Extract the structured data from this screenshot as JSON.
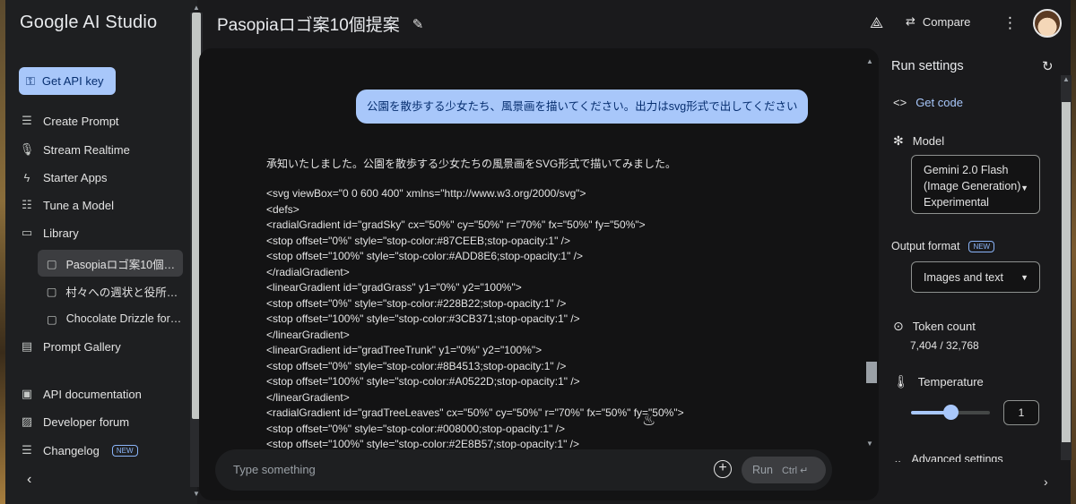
{
  "app": {
    "name": "Google AI Studio",
    "prompt_title": "Pasopiaロゴ案10個提案"
  },
  "sidebar": {
    "api_key_label": "Get API key",
    "nav": [
      {
        "label": "Create Prompt",
        "icon": "create-prompt-icon"
      },
      {
        "label": "Stream Realtime",
        "icon": "microphone-icon"
      },
      {
        "label": "Starter Apps",
        "icon": "bolt-icon"
      },
      {
        "label": "Tune a Model",
        "icon": "tune-icon"
      },
      {
        "label": "Library",
        "icon": "library-icon"
      }
    ],
    "library_items": [
      {
        "label": "Pasopiaロゴ案10個提案",
        "active": true
      },
      {
        "label": "村々への週状と役所の…",
        "active": false
      },
      {
        "label": "Chocolate Drizzle for …",
        "active": false
      }
    ],
    "prompt_gallery": "Prompt Gallery",
    "footer": [
      {
        "label": "API documentation",
        "icon": "document-icon"
      },
      {
        "label": "Developer forum",
        "icon": "forum-icon"
      },
      {
        "label": "Changelog",
        "icon": "changelog-icon",
        "badge": "NEW"
      }
    ]
  },
  "header": {
    "compare_label": "Compare"
  },
  "chat": {
    "user_message": "公園を散歩する少女たち、風景画を描いてください。出力はsvg形式で出してください",
    "reply_intro": "承知いたしました。公園を散歩する少女たちの風景画をSVG形式で描いてみました。",
    "reply_lines": [
      "<svg viewBox=\"0 0 600 400\" xmlns=\"http://www.w3.org/2000/svg\">",
      "<defs>",
      "<radialGradient id=\"gradSky\" cx=\"50%\" cy=\"50%\" r=\"70%\" fx=\"50%\" fy=\"50%\">",
      "<stop offset=\"0%\" style=\"stop-color:#87CEEB;stop-opacity:1\" />",
      "<stop offset=\"100%\" style=\"stop-color:#ADD8E6;stop-opacity:1\" />",
      "</radialGradient>",
      "<linearGradient id=\"gradGrass\" y1=\"0%\" y2=\"100%\">",
      "<stop offset=\"0%\" style=\"stop-color:#228B22;stop-opacity:1\" />",
      "<stop offset=\"100%\" style=\"stop-color:#3CB371;stop-opacity:1\" />",
      "</linearGradient>",
      "<linearGradient id=\"gradTreeTrunk\" y1=\"0%\" y2=\"100%\">",
      "<stop offset=\"0%\" style=\"stop-color:#8B4513;stop-opacity:1\" />",
      "<stop offset=\"100%\" style=\"stop-color:#A0522D;stop-opacity:1\" />",
      "</linearGradient>",
      "<radialGradient id=\"gradTreeLeaves\" cx=\"50%\" cy=\"50%\" r=\"70%\" fx=\"50%\" fy=\"50%\">",
      "<stop offset=\"0%\" style=\"stop-color:#008000;stop-opacity:1\" />",
      "<stop offset=\"100%\" style=\"stop-color:#2E8B57;stop-opacity:1\" />"
    ],
    "input_placeholder": "Type something",
    "run_label": "Run",
    "run_shortcut": "Ctrl ↵"
  },
  "run_settings": {
    "title": "Run settings",
    "get_code": "Get code",
    "model_label": "Model",
    "model_value": [
      "Gemini 2.0 Flash",
      "(Image Generation)",
      "Experimental"
    ],
    "output_format_label": "Output format",
    "output_format_badge": "NEW",
    "output_format_value": "Images and text",
    "token_count_label": "Token count",
    "token_count_value": "7,404 / 32,768",
    "temperature_label": "Temperature",
    "temperature_value": "1",
    "temperature_fraction": 0.5,
    "advanced_label": "Advanced settings"
  },
  "colors": {
    "accent": "#a8c7fa",
    "accent_text": "#062e6f",
    "panel": "#131314",
    "sidebar": "#1e1f21"
  }
}
